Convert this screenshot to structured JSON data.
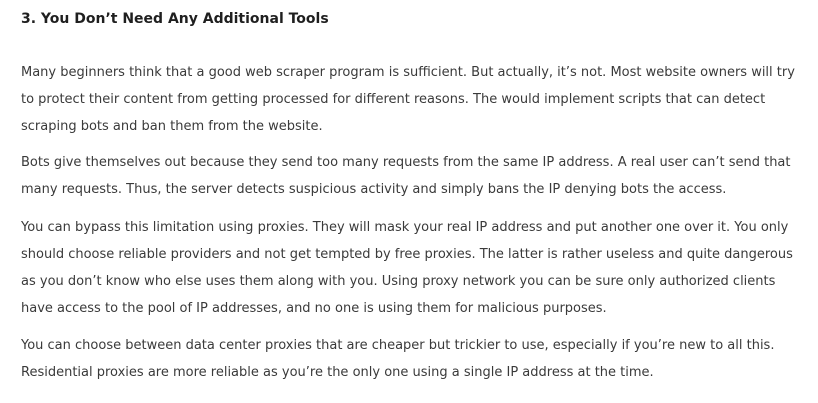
{
  "article": {
    "heading": "3. You Don’t Need Any Additional Tools",
    "paragraphs": [
      "Many beginners think that a good web scraper program is sufficient. But actually, it’s not. Most website owners will try to protect their content from getting processed for different reasons. The would implement scripts that can detect scraping bots and ban them from the website.",
      "Bots give themselves out because they send too many requests from the same IP address. A real user can’t send that many requests. Thus, the server detects suspicious activity and simply bans the IP denying bots the access.",
      "You can bypass this limitation using proxies. They will mask your real IP address and put another one over it. You only should choose reliable providers and not get tempted by free proxies. The latter is rather useless and quite dangerous as you don’t know who else uses them along with you. Using proxy network you can be sure only authorized clients have access to the pool of IP addresses, and no one is using them for malicious purposes.",
      "You can choose between data center proxies that are cheaper but trickier to use, especially if you’re new to all this. Residential proxies are more reliable as you’re the only one using a single IP address at the time."
    ]
  }
}
